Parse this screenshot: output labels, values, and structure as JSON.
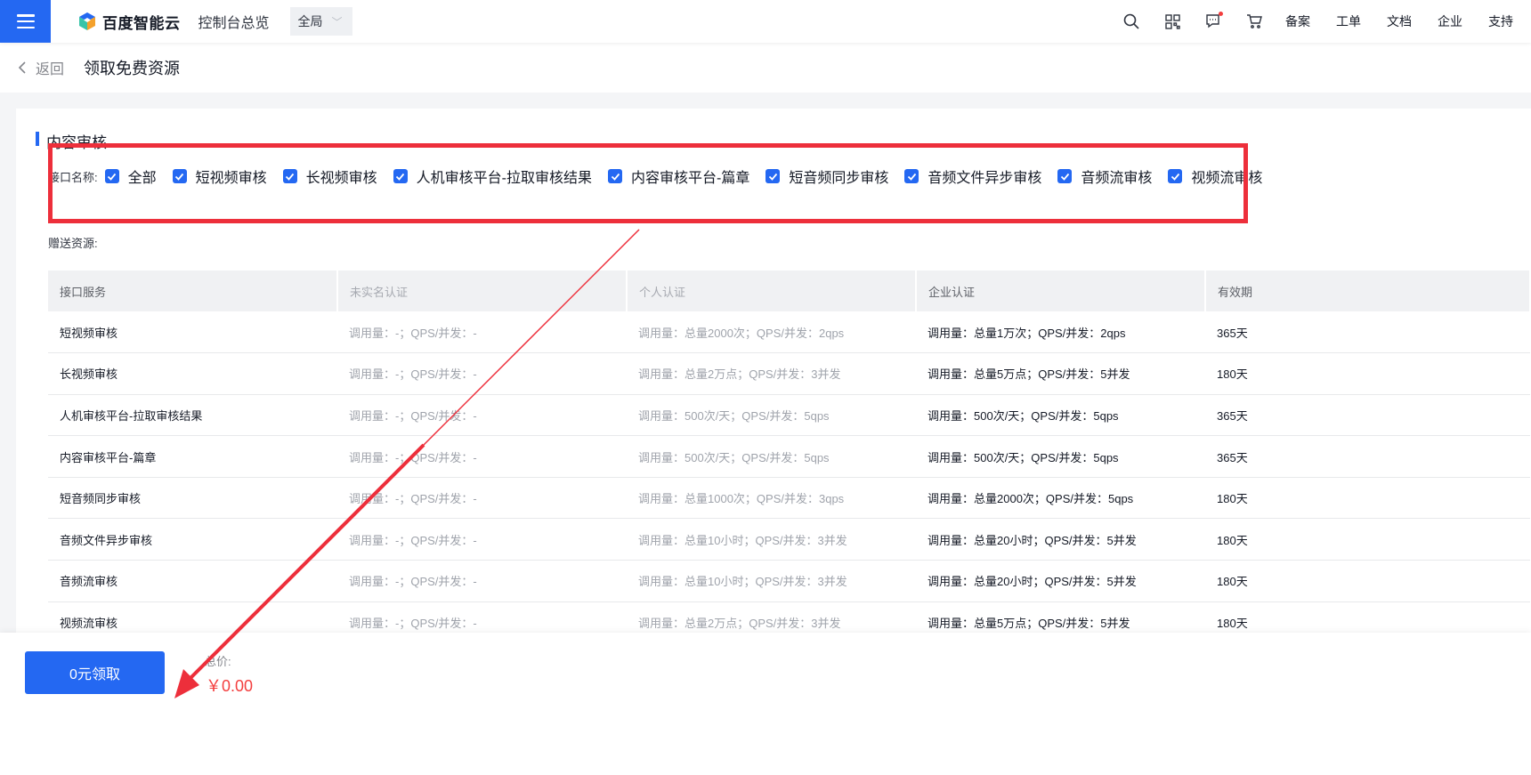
{
  "topbar": {
    "brand": "百度智能云",
    "overview": "控制台总览",
    "region": "全局",
    "links": [
      "备案",
      "工单",
      "文档",
      "企业",
      "支持"
    ],
    "icons": [
      "search-icon",
      "qrcode-icon",
      "message-icon",
      "cart-icon"
    ]
  },
  "subheader": {
    "back": "返回",
    "title": "领取免费资源"
  },
  "section": {
    "title": "内容审核",
    "api_label": "接口名称:",
    "checkboxes": [
      "全部",
      "短视频审核",
      "长视频审核",
      "人机审核平台-拉取审核结果",
      "内容审核平台-篇章",
      "短音频同步审核",
      "音频文件异步审核",
      "音频流审核",
      "视频流审核"
    ],
    "gift_label": "赠送资源:"
  },
  "table": {
    "headers": [
      "接口服务",
      "未实名认证",
      "个人认证",
      "企业认证",
      "有效期"
    ],
    "rows": [
      [
        "短视频审核",
        "调用量：-；QPS/并发：-",
        "调用量：总量2000次；QPS/并发：2qps",
        "调用量：总量1万次；QPS/并发：2qps",
        "365天"
      ],
      [
        "长视频审核",
        "调用量：-；QPS/并发：-",
        "调用量：总量2万点；QPS/并发：3并发",
        "调用量：总量5万点；QPS/并发：5并发",
        "180天"
      ],
      [
        "人机审核平台-拉取审核结果",
        "调用量：-；QPS/并发：-",
        "调用量：500次/天；QPS/并发：5qps",
        "调用量：500次/天；QPS/并发：5qps",
        "365天"
      ],
      [
        "内容审核平台-篇章",
        "调用量：-；QPS/并发：-",
        "调用量：500次/天；QPS/并发：5qps",
        "调用量：500次/天；QPS/并发：5qps",
        "365天"
      ],
      [
        "短音频同步审核",
        "调用量：-；QPS/并发：-",
        "调用量：总量1000次；QPS/并发：3qps",
        "调用量：总量2000次；QPS/并发：5qps",
        "180天"
      ],
      [
        "音频文件异步审核",
        "调用量：-；QPS/并发：-",
        "调用量：总量10小时；QPS/并发：3并发",
        "调用量：总量20小时；QPS/并发：5并发",
        "180天"
      ],
      [
        "音频流审核",
        "调用量：-；QPS/并发：-",
        "调用量：总量10小时；QPS/并发：3并发",
        "调用量：总量20小时；QPS/并发：5并发",
        "180天"
      ],
      [
        "视频流审核",
        "调用量：-；QPS/并发：-",
        "调用量：总量2万点；QPS/并发：3并发",
        "调用量：总量5万点；QPS/并发：5并发",
        "180天"
      ]
    ]
  },
  "footer": {
    "claim_button": "0元领取",
    "total_label": "总价:",
    "total_value": "￥0.00"
  },
  "colors": {
    "primary": "#2468f2",
    "annotation": "#ed2f3b",
    "price": "#f33e3e"
  }
}
